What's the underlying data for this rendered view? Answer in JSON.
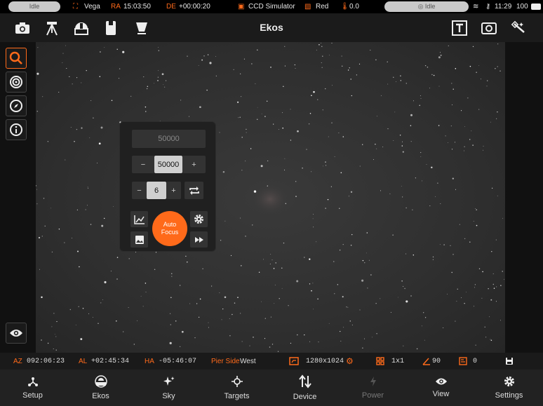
{
  "status_bar": {
    "left_status": "Idle",
    "target": "Vega",
    "ra_label": "RA",
    "ra_value": "15:03:50",
    "de_label": "DE",
    "de_value": "+00:00:20",
    "camera": "CCD Simulator",
    "filter": "Red",
    "temperature": "0.0",
    "right_status": "Idle",
    "time": "11:29",
    "battery": "100"
  },
  "toolbar": {
    "title": "Ekos"
  },
  "focus": {
    "target_position": "50000",
    "current_position": "50000",
    "step": "6",
    "minus": "−",
    "plus": "+",
    "autofocus_line1": "Auto",
    "autofocus_line2": "Focus"
  },
  "info_bar": {
    "az_label": "AZ",
    "az_value": "092:06:23",
    "al_label": "AL",
    "al_value": "+02:45:34",
    "ha_label": "HA",
    "ha_value": "-05:46:07",
    "pier_label": "Pier Side",
    "pier_value": "West",
    "resolution": "1280x1024",
    "binning": "1x1",
    "rotation": "90",
    "count": "0"
  },
  "nav": {
    "items": [
      {
        "label": "Setup"
      },
      {
        "label": "Ekos"
      },
      {
        "label": "Sky"
      },
      {
        "label": "Targets"
      },
      {
        "label": "Device"
      },
      {
        "label": "Power"
      },
      {
        "label": "View"
      },
      {
        "label": "Settings"
      }
    ]
  },
  "colors": {
    "accent": "#ff6a1a",
    "background": "#111111",
    "panel": "#202020"
  }
}
